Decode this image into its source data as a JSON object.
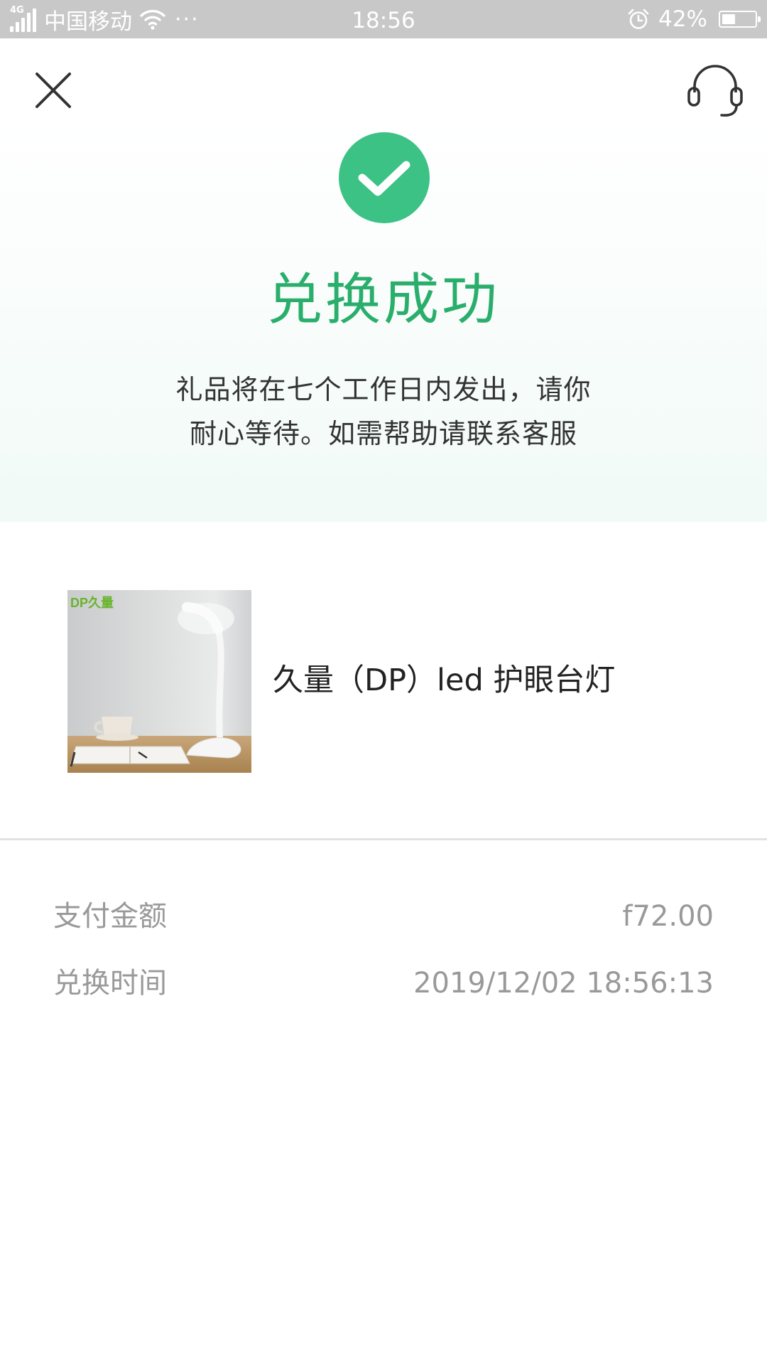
{
  "status_bar": {
    "network": "4G",
    "carrier": "中国移动",
    "dots": "···",
    "time": "18:56",
    "battery_text": "42%",
    "battery_level": 0.42,
    "icons": [
      "signal-icon",
      "wifi-icon",
      "alarm-icon",
      "battery-icon"
    ]
  },
  "header": {
    "close_icon": "close-icon",
    "service_icon": "headset-icon"
  },
  "result": {
    "icon": "check-circle-icon",
    "title": "兑换成功",
    "desc_line1": "礼品将在七个工作日内发出，请你",
    "desc_line2": "耐心等待。如需帮助请联系客服"
  },
  "product": {
    "brand_logo": "DP久量",
    "name": "久量（DP）led 护眼台灯"
  },
  "details": {
    "payment_label": "支付金额",
    "payment_value": "f72.00",
    "time_label": "兑换时间",
    "time_value": "2019/12/02 18:56:13"
  },
  "colors": {
    "accent": "#2aae6c",
    "success_circle": "#3cc284",
    "status_bar": "#c8c8c8",
    "muted_text": "#999999"
  }
}
